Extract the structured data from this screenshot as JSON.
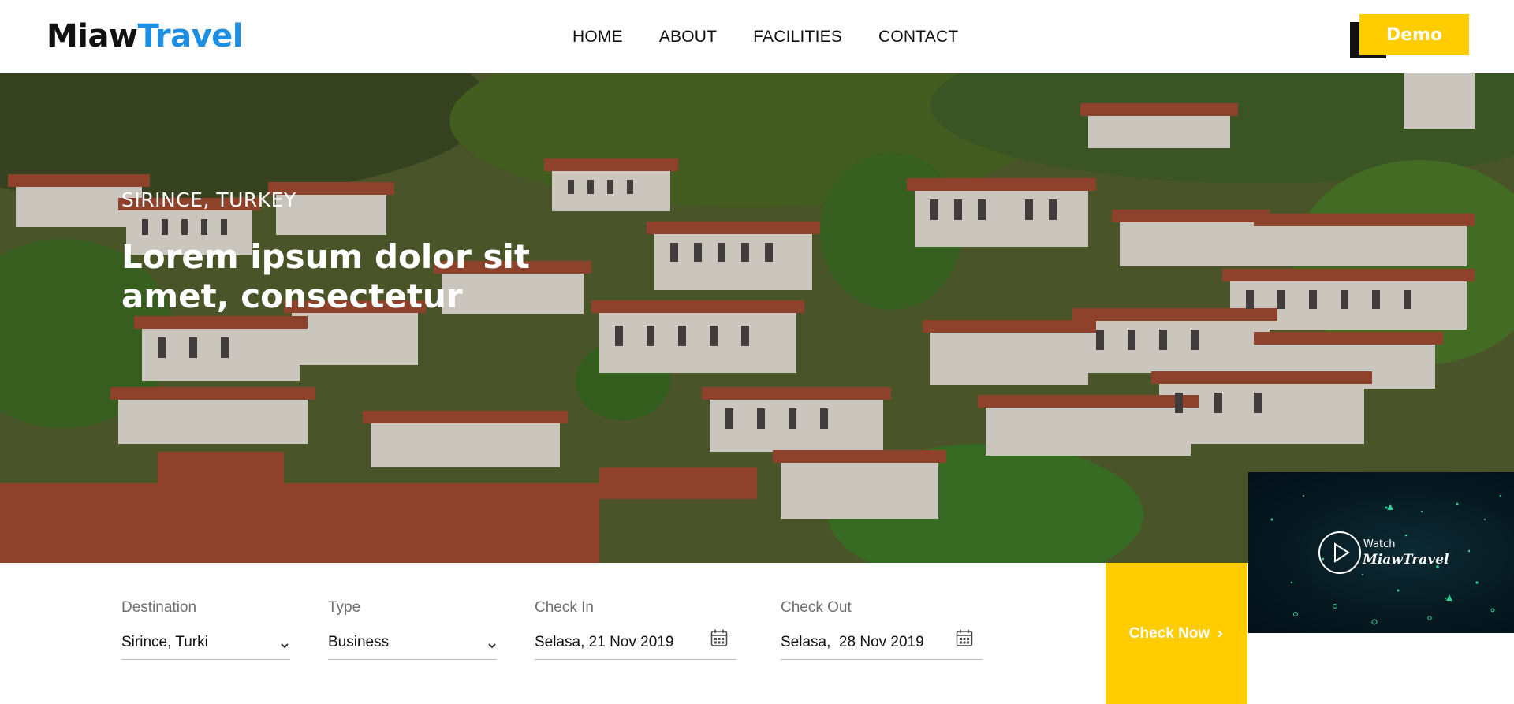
{
  "brand": {
    "part1": "Miaw",
    "part2": "Travel"
  },
  "nav": [
    {
      "label": "HOME"
    },
    {
      "label": "ABOUT"
    },
    {
      "label": "FACILITIES"
    },
    {
      "label": "CONTACT"
    }
  ],
  "demo_button": "Demo",
  "hero": {
    "subtitle": "SIRINCE, TURKEY",
    "title": "Lorem ipsum dolor sit amet, consectetur"
  },
  "video": {
    "watch_label": "Watch",
    "brand": "MiawTravel"
  },
  "booking": {
    "destination": {
      "label": "Destination",
      "value": "Sirince, Turki"
    },
    "type": {
      "label": "Type",
      "value": "Business"
    },
    "check_in": {
      "label": "Check In",
      "value": "Selasa, 21 Nov 2019"
    },
    "check_out": {
      "label": "Check Out",
      "value": "Selasa,  28 Nov 2019"
    },
    "submit": "Check Now",
    "submit_icon": "chevron-right-icon"
  },
  "colors": {
    "accent": "#ffcc00",
    "brand_blue": "#1e8fe0",
    "dark": "#111111"
  }
}
